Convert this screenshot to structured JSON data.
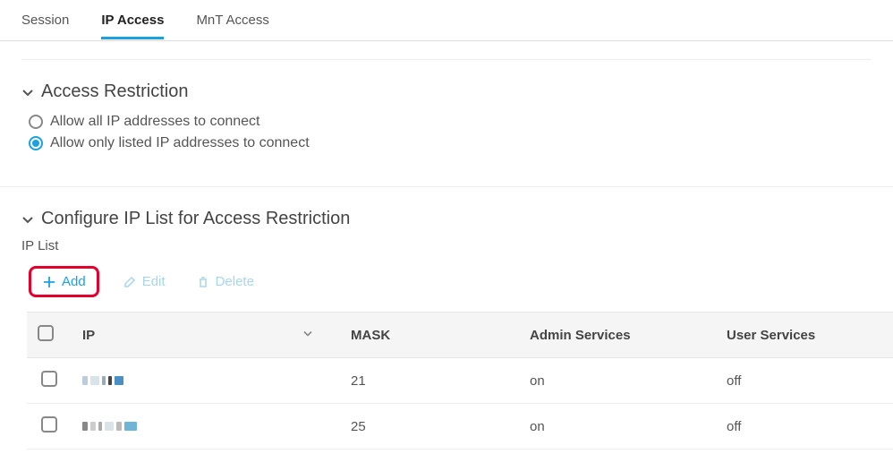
{
  "tabs": {
    "session": "Session",
    "ip_access": "IP Access",
    "mnt_access": "MnT Access"
  },
  "access_restriction": {
    "title": "Access Restriction",
    "allow_all": "Allow all IP addresses to connect",
    "allow_only": "Allow only listed IP addresses to connect",
    "selected": "allow_only"
  },
  "ip_list_section": {
    "title": "Configure IP List for Access Restriction",
    "subtitle": "IP List"
  },
  "toolbar": {
    "add": "Add",
    "edit": "Edit",
    "delete": "Delete"
  },
  "table": {
    "headers": {
      "ip": "IP",
      "mask": "MASK",
      "admin": "Admin Services",
      "user": "User Services"
    },
    "rows": [
      {
        "ip": "▓▓.▓.▓▓",
        "mask": "21",
        "admin": "on",
        "user": "off"
      },
      {
        "ip": "▓▓.▓.▓▓.▓▓▓",
        "mask": "25",
        "admin": "on",
        "user": "off"
      }
    ]
  }
}
